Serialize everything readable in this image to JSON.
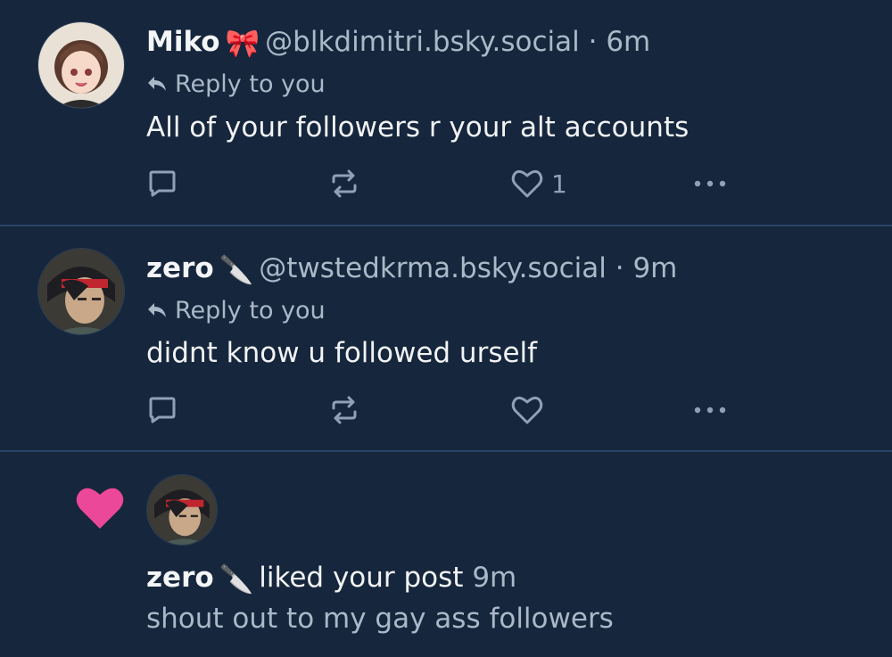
{
  "posts": [
    {
      "author_name": "Miko",
      "author_emoji": "🎀",
      "handle": "@blkdimitri.bsky.social",
      "separator": "·",
      "time": "6m",
      "reply_label": "Reply to you",
      "text": "All of your followers r your alt accounts",
      "like_count": "1",
      "icons": [
        "reply-icon",
        "repost-icon",
        "heart-icon",
        "more-icon"
      ]
    },
    {
      "author_name": "zero",
      "author_emoji": "🔪",
      "handle": "@twstedkrma.bsky.social",
      "separator": "·",
      "time": "9m",
      "reply_label": "Reply to you",
      "text": "didnt know u followed urself",
      "like_count": "",
      "icons": [
        "reply-icon",
        "repost-icon",
        "heart-icon",
        "more-icon"
      ]
    }
  ],
  "notification": {
    "icon": "heart-icon",
    "icon_color": "#ec4899",
    "author_name": "zero",
    "author_emoji": "🔪",
    "action": "liked your post",
    "time": "9m",
    "snippet": "shout out to my gay ass followers"
  },
  "colors": {
    "background": "#16263c",
    "divider": "#2a4468",
    "muted": "#aab8c8"
  }
}
